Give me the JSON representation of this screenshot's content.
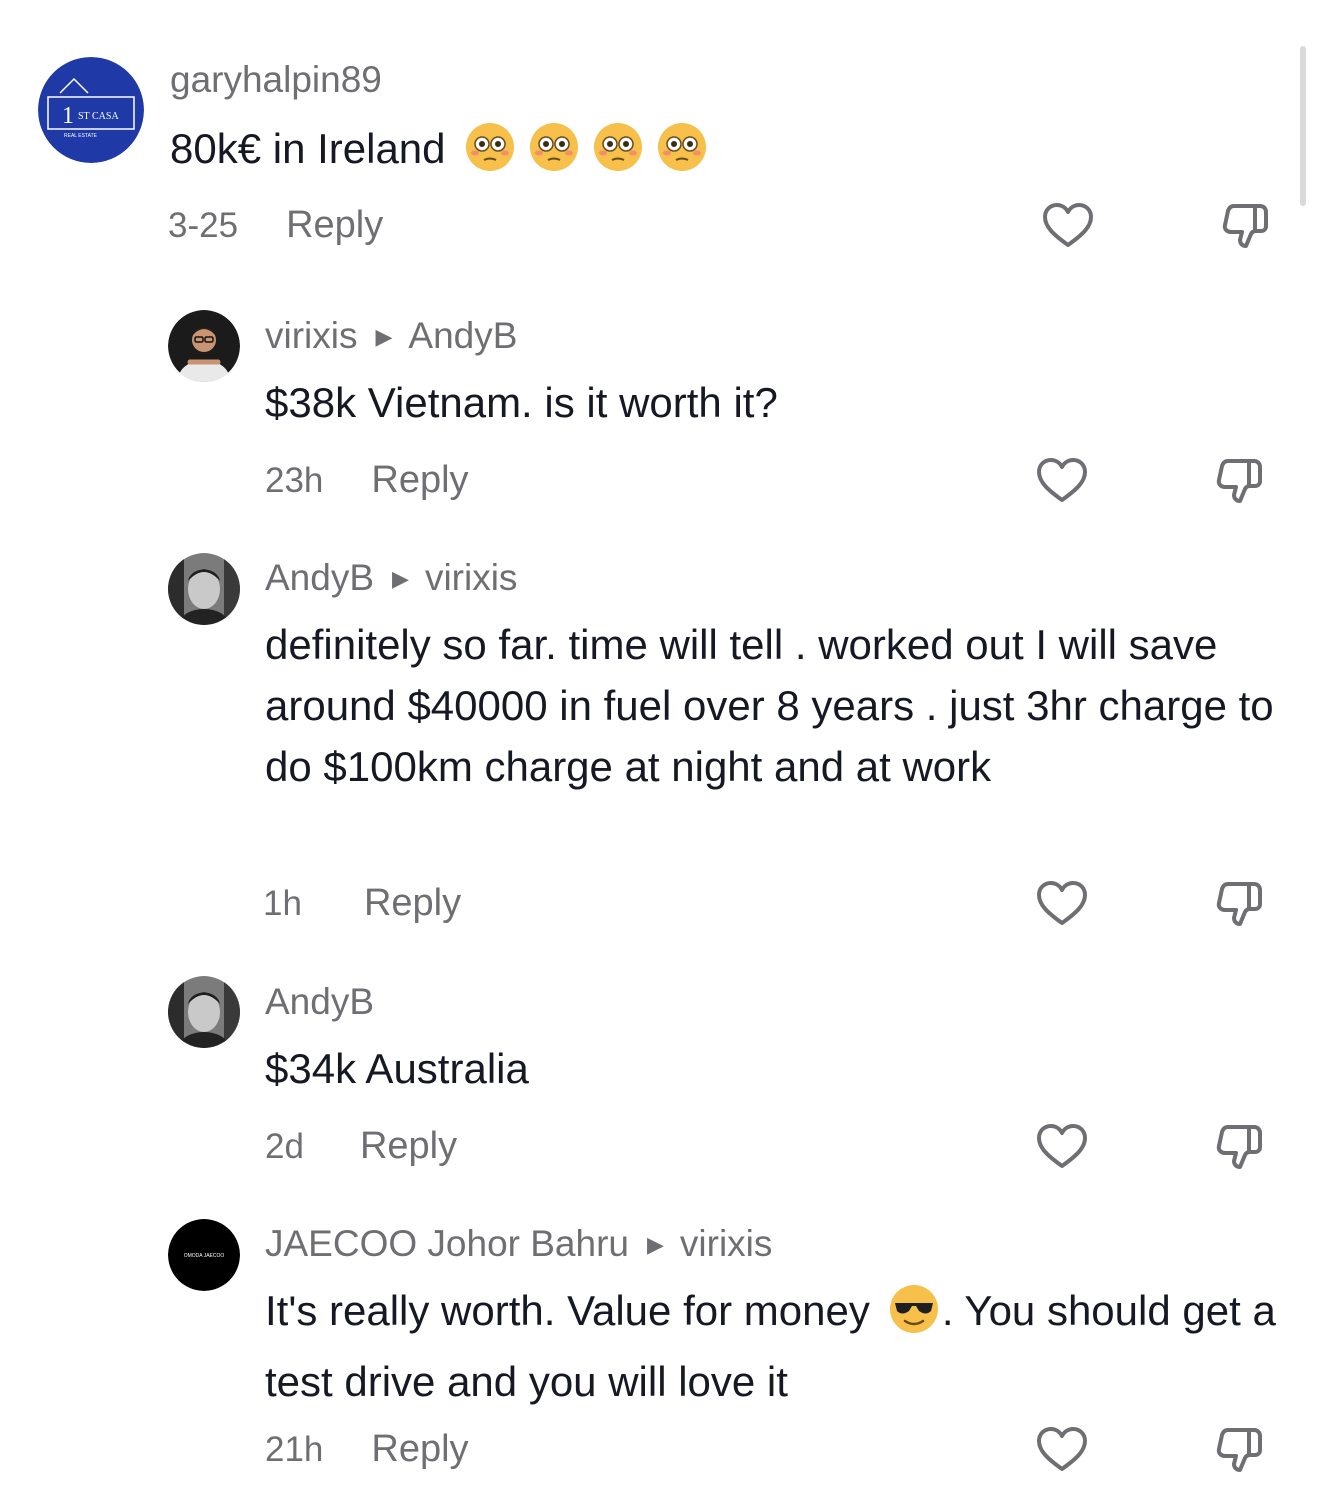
{
  "comments": [
    {
      "username": "garyhalpin89",
      "reply_to": "",
      "text": "80k€ in Ireland",
      "emoji_count": 4,
      "time": "3-25",
      "reply_label": "Reply",
      "avatar": {
        "text_top": "ST CASA",
        "text_bottom": "REAL ESTATE",
        "digit": "1",
        "color": "#1f3aa6"
      }
    },
    {
      "username": "virixis",
      "reply_to": "AndyB",
      "text": "$38k Vietnam. is it worth it?",
      "time": "23h",
      "reply_label": "Reply"
    },
    {
      "username": "AndyB",
      "reply_to": "virixis",
      "text": "definitely so far. time will tell . worked out I will save around $40000 in fuel over 8 years . just 3hr charge to do $100km charge at night and at work",
      "time": "1h",
      "reply_label": "Reply"
    },
    {
      "username": "AndyB",
      "reply_to": "",
      "text": "$34k Australia",
      "time": "2d",
      "reply_label": "Reply"
    },
    {
      "username": "JAECOO Johor Bahru",
      "reply_to": "virixis",
      "text_before_emoji": "It's really worth. Value for money",
      "text_after_emoji": ". You should get a test drive and you will love it",
      "time": "21h",
      "reply_label": "Reply",
      "avatar": {
        "logo_text": "OMODA JAECOO"
      }
    }
  ],
  "icons": {
    "like": "heart-outline-icon",
    "dislike": "thumbs-down-outline-icon",
    "flushed_emoji": "flushed-face-emoji",
    "sunglasses_emoji": "smiling-face-with-sunglasses-emoji",
    "reply_arrow": "play-triangle-icon"
  },
  "colors": {
    "text_primary": "#161823",
    "text_secondary": "#6e6e73",
    "icon": "#6e6e73"
  }
}
